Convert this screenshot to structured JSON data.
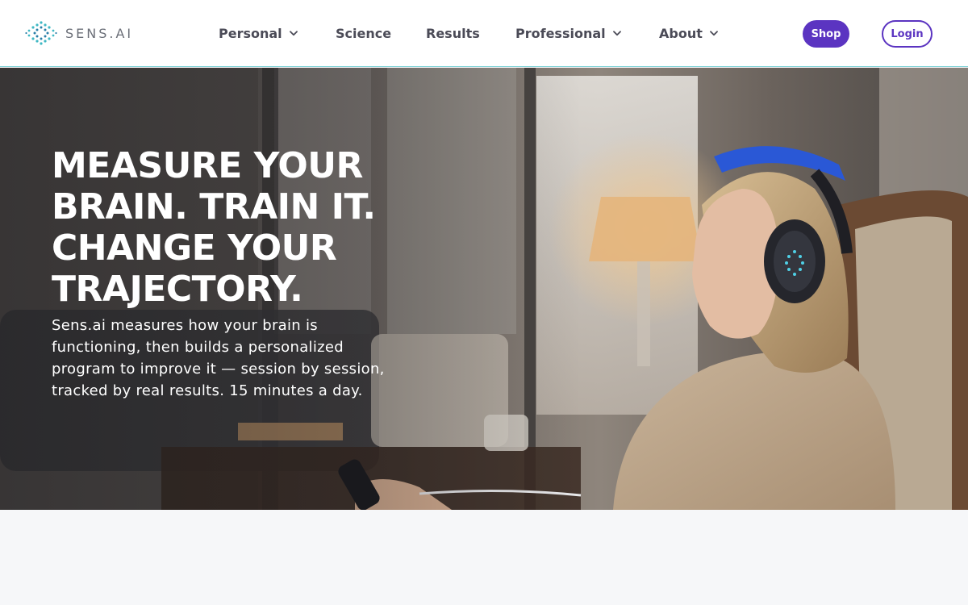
{
  "brand": {
    "name": "SENS.AI",
    "logo_icon": "hexagon-dot-logo-icon",
    "accent_color": "#5b34c1",
    "teal_color": "#3fb8c4"
  },
  "nav": {
    "items": [
      {
        "label": "Personal",
        "has_dropdown": true
      },
      {
        "label": "Science",
        "has_dropdown": false
      },
      {
        "label": "Results",
        "has_dropdown": false
      },
      {
        "label": "Professional",
        "has_dropdown": true
      },
      {
        "label": "About",
        "has_dropdown": true
      }
    ],
    "shop_label": "Shop",
    "login_label": "Login"
  },
  "hero": {
    "title_lines": [
      "MEASURE YOUR",
      "BRAIN. TRAIN IT.",
      "CHANGE YOUR",
      "TRAJECTORY."
    ],
    "description": "Sens.ai measures how your brain is functioning, then builds a personalized program to improve it — session by session, tracked by real results. 15 minutes a day.",
    "image_subject": "woman-relaxing-with-neurofeedback-headset"
  }
}
